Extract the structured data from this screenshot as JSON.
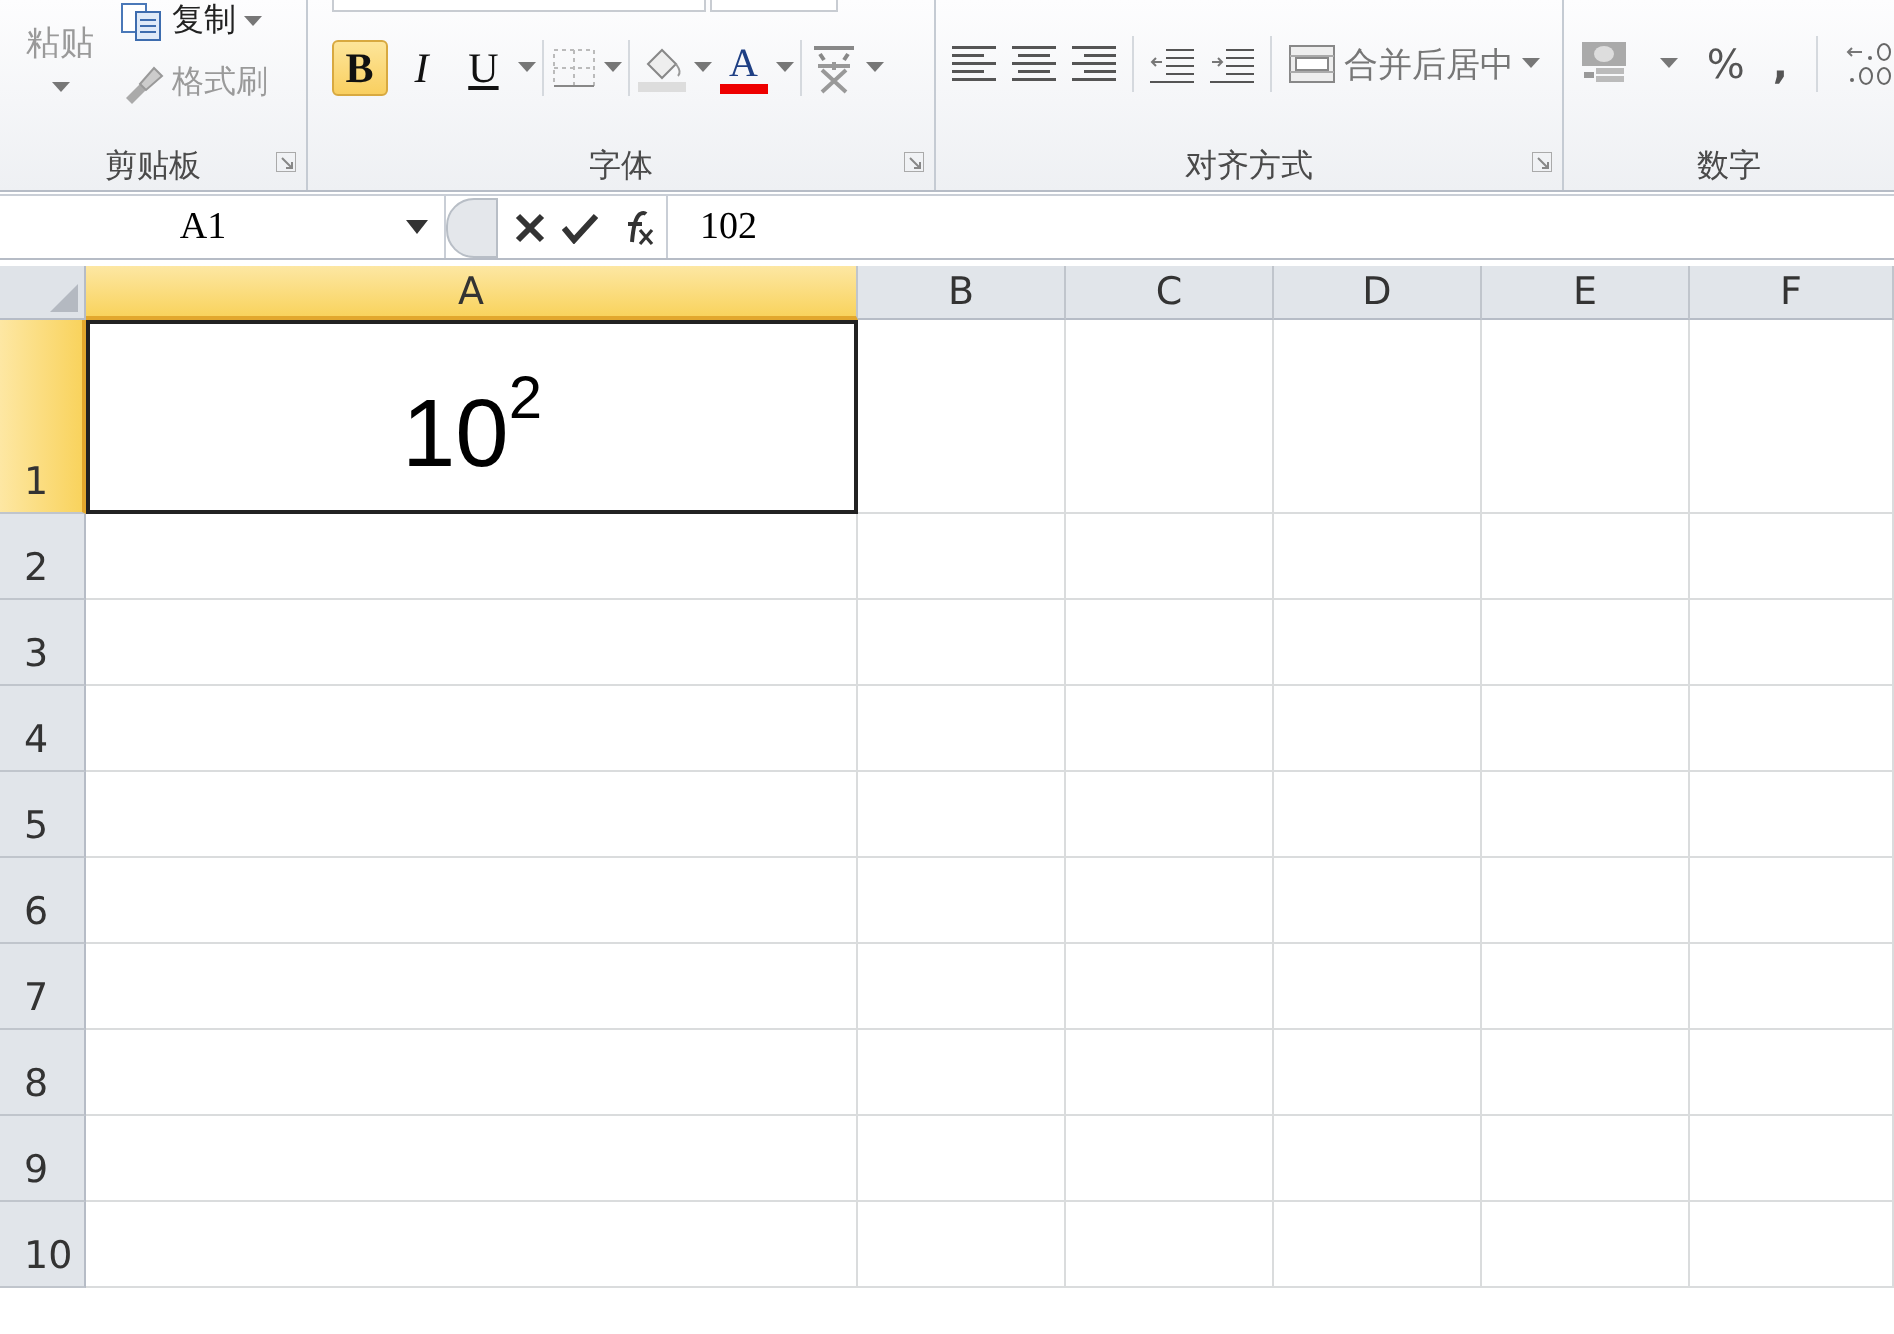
{
  "ribbon": {
    "groups": [
      {
        "kind": "clipboard",
        "label": "剪贴板",
        "paste": "粘贴",
        "copy": "复制",
        "format_painter": "格式刷",
        "launcher": true
      },
      {
        "kind": "font",
        "label": "字体",
        "launcher": true,
        "buttons": [
          {
            "kind": "bold",
            "label": "B",
            "selected": true
          },
          {
            "kind": "italic",
            "label": "I",
            "selected": false
          },
          {
            "kind": "underline",
            "label": "U",
            "selected": false
          }
        ],
        "font_color": "A"
      },
      {
        "kind": "alignment",
        "label": "对齐方式",
        "launcher": true,
        "merge": "合并后居中"
      },
      {
        "kind": "number",
        "label": "数字",
        "percent": "%",
        "comma": ","
      }
    ]
  },
  "formula_bar": {
    "name_box": "A1",
    "formula": "102"
  },
  "sheet": {
    "columns": [
      {
        "label": "A",
        "selected": true
      },
      {
        "label": "B",
        "selected": false
      },
      {
        "label": "C",
        "selected": false
      },
      {
        "label": "D",
        "selected": false
      },
      {
        "label": "E",
        "selected": false
      },
      {
        "label": "F",
        "selected": false
      }
    ],
    "rows": [
      {
        "label": "1",
        "selected": true,
        "cells": [
          "10$^{2}$"
        ]
      },
      {
        "label": "2",
        "selected": false,
        "cells": []
      },
      {
        "label": "3",
        "selected": false,
        "cells": []
      },
      {
        "label": "4",
        "selected": false,
        "cells": []
      },
      {
        "label": "5",
        "selected": false,
        "cells": []
      },
      {
        "label": "6",
        "selected": false,
        "cells": []
      },
      {
        "label": "7",
        "selected": false,
        "cells": []
      },
      {
        "label": "8",
        "selected": false,
        "cells": []
      },
      {
        "label": "9",
        "selected": false,
        "cells": []
      },
      {
        "label": "10",
        "selected": false,
        "cells": []
      }
    ]
  }
}
